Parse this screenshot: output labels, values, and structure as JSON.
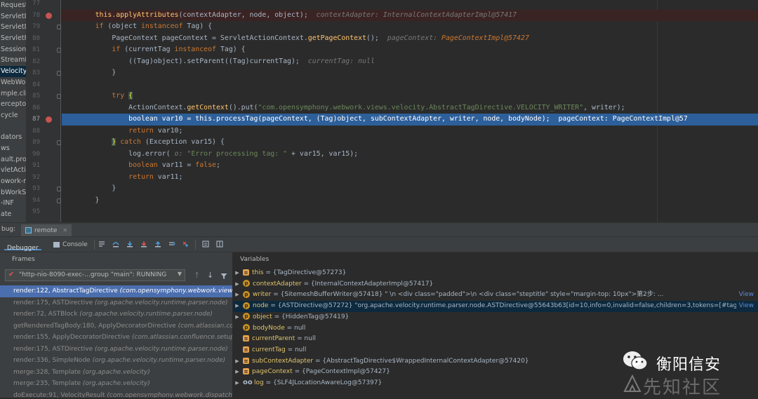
{
  "project_tree": {
    "items": [
      "Request",
      "ServletD",
      "ServletD",
      "ServletR",
      "SessionM",
      "StreamR",
      "Velocity",
      "WebWor",
      "mple.cli",
      "erceptor",
      "cycle",
      "",
      "dators",
      "ws",
      "ault.pro",
      "vletActi",
      "owork-m",
      "bWorkS",
      "-INF",
      "ate"
    ],
    "selected_index": 6
  },
  "editor": {
    "lines": [
      {
        "num": "77",
        "tokens": []
      },
      {
        "num": "78",
        "breakpoint": true,
        "tokens": [
          [
            "",
            "        "
          ],
          [
            "fn",
            "this.applyAttributes"
          ],
          [
            "",
            "(contextAdapter, node, object);  "
          ],
          [
            "hint",
            "contextAdapter: InternalContextAdapterImpl@57417"
          ]
        ]
      },
      {
        "num": "79",
        "tokens": [
          [
            "",
            "        "
          ],
          [
            "kw",
            "if "
          ],
          [
            "",
            "(object "
          ],
          [
            "kw",
            "instanceof "
          ],
          [
            "",
            "Tag) {"
          ]
        ]
      },
      {
        "num": "80",
        "tokens": [
          [
            "",
            "            PageContext pageContext = ServletActionContext."
          ],
          [
            "fn",
            "getPageContext"
          ],
          [
            "",
            "();  "
          ],
          [
            "hint",
            "pageContext: "
          ],
          [
            "hintval",
            "PageContextImpl@57427"
          ]
        ]
      },
      {
        "num": "81",
        "tokens": [
          [
            "",
            "            "
          ],
          [
            "kw",
            "if "
          ],
          [
            "",
            "(currentTag "
          ],
          [
            "kw",
            "instanceof "
          ],
          [
            "",
            "Tag) {"
          ]
        ]
      },
      {
        "num": "82",
        "tokens": [
          [
            "",
            "                ((Tag)object).setParent((Tag)currentTag);  "
          ],
          [
            "hint",
            "currentTag: null"
          ]
        ]
      },
      {
        "num": "83",
        "tokens": [
          [
            "",
            "            }"
          ]
        ]
      },
      {
        "num": "84",
        "tokens": []
      },
      {
        "num": "85",
        "tokens": [
          [
            "",
            "            "
          ],
          [
            "kw",
            "try "
          ],
          [
            "brace",
            "{"
          ]
        ]
      },
      {
        "num": "86",
        "tokens": [
          [
            "",
            "                ActionContext."
          ],
          [
            "fn",
            "getContext"
          ],
          [
            "",
            "().put("
          ],
          [
            "str",
            "\"com.opensymphony.webwork.views.velocity.AbstractTagDirective.VELOCITY_WRITER\""
          ],
          [
            "",
            ", writer);"
          ]
        ]
      },
      {
        "num": "87",
        "exec": true,
        "breakpoint": true,
        "tokens": [
          [
            "",
            "                boolean var10 = this.processTag(pageContext, (Tag)object, subContextAdapter, writer, node, bodyNode);  pageContext: PageContextImpl@57"
          ]
        ]
      },
      {
        "num": "88",
        "tokens": [
          [
            "",
            "                "
          ],
          [
            "kw",
            "return "
          ],
          [
            "",
            "var10;"
          ]
        ]
      },
      {
        "num": "89",
        "tokens": [
          [
            "",
            "            "
          ],
          [
            "brace",
            "}"
          ],
          [
            "kw",
            " catch "
          ],
          [
            "",
            "(Exception var15) {"
          ]
        ]
      },
      {
        "num": "90",
        "tokens": [
          [
            "",
            "                log.error( "
          ],
          [
            "hint",
            "o: "
          ],
          [
            "str",
            "\"Error processing tag: \""
          ],
          [
            "",
            " + var15, var15);"
          ]
        ]
      },
      {
        "num": "91",
        "tokens": [
          [
            "",
            "                "
          ],
          [
            "kw",
            "boolean "
          ],
          [
            "",
            "var11 = "
          ],
          [
            "kw",
            "false"
          ],
          [
            "",
            ";"
          ]
        ]
      },
      {
        "num": "92",
        "tokens": [
          [
            "",
            "                "
          ],
          [
            "kw",
            "return "
          ],
          [
            "",
            "var11;"
          ]
        ]
      },
      {
        "num": "93",
        "tokens": [
          [
            "",
            "            }"
          ]
        ]
      },
      {
        "num": "94",
        "tokens": [
          [
            "",
            "        }"
          ]
        ]
      },
      {
        "num": "95",
        "tokens": []
      }
    ]
  },
  "debug": {
    "label": "bug:",
    "session_tab": "remote",
    "tabs": [
      "Debugger",
      "Console"
    ]
  },
  "frames": {
    "title": "Frames",
    "thread": "\"http-nio-8090-exec-...group \"main\": RUNNING",
    "rows": [
      {
        "method": "render:122, AbstractTagDirective",
        "pkg": "(com.opensymphony.webwork.views"
      },
      {
        "method": "render:175, ASTDirective",
        "pkg": "(org.apache.velocity.runtime.parser.node)"
      },
      {
        "method": "render:72, ASTBlock",
        "pkg": "(org.apache.velocity.runtime.parser.node)"
      },
      {
        "method": "getRenderedTagBody:180, ApplyDecoratorDirective",
        "pkg": "(com.atlassian.co"
      },
      {
        "method": "render:155, ApplyDecoratorDirective",
        "pkg": "(com.atlassian.confluence.setup."
      },
      {
        "method": "render:175, ASTDirective",
        "pkg": "(org.apache.velocity.runtime.parser.node)"
      },
      {
        "method": "render:336, SimpleNode",
        "pkg": "(org.apache.velocity.runtime.parser.node)"
      },
      {
        "method": "merge:328, Template",
        "pkg": "(org.apache.velocity)"
      },
      {
        "method": "merge:235, Template",
        "pkg": "(org.apache.velocity)"
      },
      {
        "method": "doExecute:91, VelocityResult",
        "pkg": "(com.opensymphony.webwork.dispatche"
      }
    ],
    "selected_index": 0
  },
  "variables": {
    "title": "Variables",
    "rows": [
      {
        "icon": "≡",
        "arrow": "▶",
        "name": "this",
        "value": "= {TagDirective@57273}"
      },
      {
        "icon": "p",
        "arrow": "▶",
        "name": "contextAdapter",
        "value": "= {InternalContextAdapterImpl@57417}"
      },
      {
        "icon": "p",
        "arrow": "▶",
        "name": "writer",
        "value": "= {SitemeshBufferWriter@57418} \"                    \\n            <div class=\"padded\">\\n            <div class=\"steptitle\" style=\"margin-top: 10px\">第2步: ...",
        "link": "View"
      },
      {
        "icon": "p",
        "arrow": "▶",
        "name": "node",
        "value": "= {ASTDirective@57272} \"org.apache.velocity.runtime.parser.node.ASTDirective@55643b63[id=10,info=0,invalid=false,children=3,tokens=[#tag]...",
        "link": "View",
        "selected": true
      },
      {
        "icon": "p",
        "arrow": "▶",
        "name": "object",
        "value": "= {HiddenTag@57419}"
      },
      {
        "icon": "p",
        "arrow": "",
        "name": "bodyNode",
        "value": "= null"
      },
      {
        "icon": "≡",
        "arrow": "",
        "name": "currentParent",
        "value": "= null"
      },
      {
        "icon": "≡",
        "arrow": "",
        "name": "currentTag",
        "value": "= null"
      },
      {
        "icon": "≡",
        "arrow": "▶",
        "name": "subContextAdapter",
        "value": "= {AbstractTagDirective$WrappedInternalContextAdapter@57420}"
      },
      {
        "icon": "≡",
        "arrow": "▶",
        "name": "pageContext",
        "value": "= {PageContextImpl@57427}"
      },
      {
        "icon": "oo",
        "arrow": "▶",
        "name": "log",
        "value": "= {SLF4JLocationAwareLog@57397}"
      }
    ]
  },
  "watermark": {
    "brand": "衡阳信安",
    "sub": "先知社区"
  }
}
